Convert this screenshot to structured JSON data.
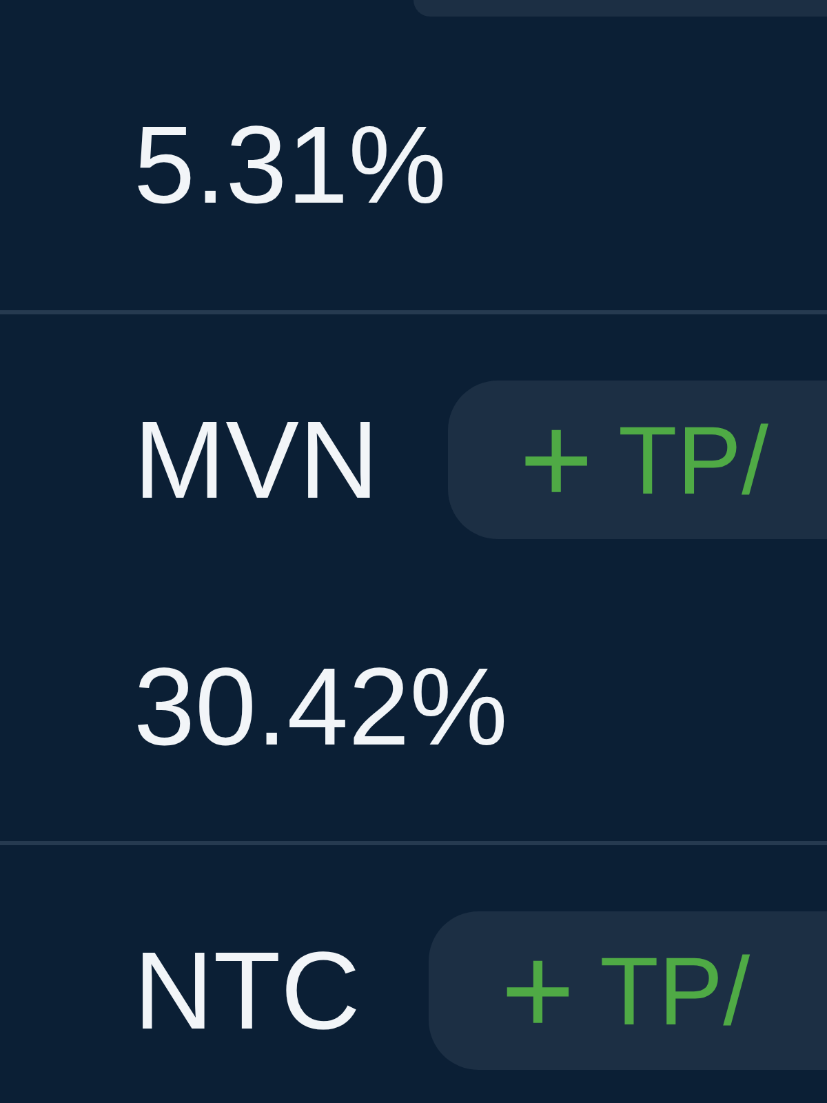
{
  "positions": [
    {
      "value": "5.31%"
    },
    {
      "symbol": "MVN",
      "button": {
        "icon": "+",
        "label": "TP/"
      },
      "value": "30.42%"
    },
    {
      "symbol": "NTC",
      "button": {
        "icon": "+",
        "label": "TP/"
      }
    }
  ]
}
